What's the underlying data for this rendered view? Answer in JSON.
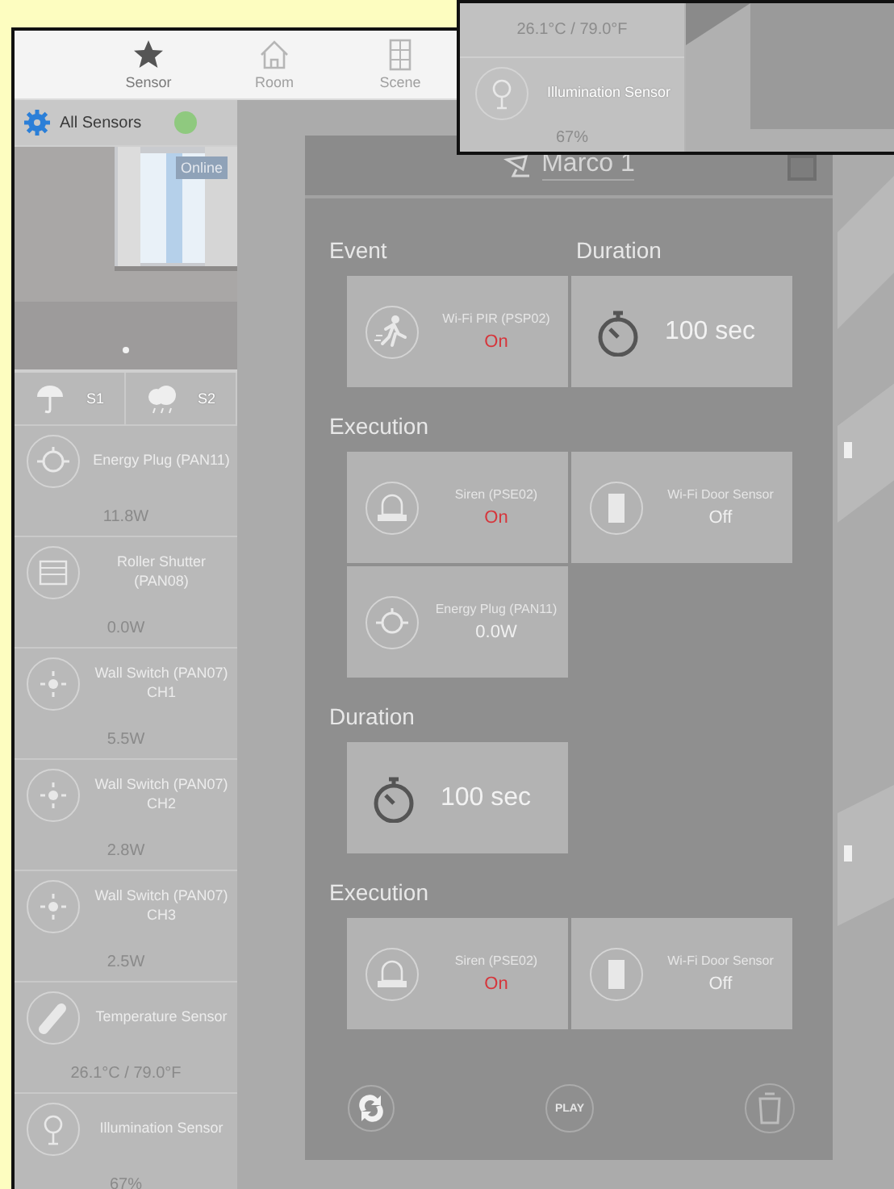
{
  "tabs": [
    {
      "label": "Sensor",
      "kind": "star",
      "selected": true
    },
    {
      "label": "Room",
      "kind": "house",
      "selected": false
    },
    {
      "label": "Scene",
      "kind": "grid",
      "selected": false
    }
  ],
  "sidebar": {
    "title": "All Sensors",
    "camera": {
      "kind": "picture",
      "badge": "Online"
    },
    "weather": [
      {
        "kind": "umbrella",
        "label": "S1"
      },
      {
        "kind": "cloud",
        "label": "S2"
      }
    ],
    "items": [
      {
        "kind": "plug",
        "name": "Energy Plug (PAN11)",
        "value": "11.8W"
      },
      {
        "kind": "shutter",
        "name": "Roller Shutter (PAN08)",
        "value": "0.0W"
      },
      {
        "kind": "switch",
        "name": "Wall Switch (PAN07) CH1",
        "value": "5.5W"
      },
      {
        "kind": "switch",
        "name": "Wall Switch (PAN07) CH2",
        "value": "2.8W"
      },
      {
        "kind": "switch",
        "name": "Wall Switch (PAN07) CH3",
        "value": "2.5W"
      },
      {
        "kind": "thermo",
        "name": "Temperature Sensor",
        "value": "26.1°C / 79.0°F"
      },
      {
        "kind": "light",
        "name": "Illumination Sensor",
        "value": "67%"
      }
    ]
  },
  "macro": {
    "title": "Marco 1",
    "blocks": [
      {
        "headings": [
          "Event",
          "Duration"
        ],
        "cards": [
          {
            "kind": "pir",
            "name": "Wi-Fi PIR (PSP02)",
            "status": "On",
            "on": true
          },
          {
            "kind": "timer",
            "value": "100 sec"
          }
        ]
      },
      {
        "headings": [
          "Execution"
        ],
        "cards": [
          {
            "kind": "siren",
            "name": "Siren (PSE02)",
            "status": "On",
            "on": true
          },
          {
            "kind": "door",
            "name": "Wi-Fi Door Sensor",
            "status": "Off",
            "on": false
          },
          {
            "kind": "plug",
            "name": "Energy Plug (PAN11)",
            "status": "0.0W",
            "on": false
          }
        ]
      },
      {
        "headings": [
          "Duration"
        ],
        "cards": [
          {
            "kind": "timer",
            "value": "100 sec"
          }
        ]
      },
      {
        "headings": [
          "Execution"
        ],
        "cards": [
          {
            "kind": "siren",
            "name": "Siren (PSE02)",
            "status": "On",
            "on": true
          },
          {
            "kind": "door",
            "name": "Wi-Fi Door Sensor",
            "status": "Off",
            "on": false
          }
        ]
      }
    ],
    "actions": [
      {
        "kind": "refresh"
      },
      {
        "kind": "play",
        "label": "PLAY"
      },
      {
        "kind": "trash"
      }
    ]
  },
  "inset": {
    "reading": "26.1°C / 79.0°F",
    "name": "Illumination Sensor",
    "value": "67%"
  }
}
